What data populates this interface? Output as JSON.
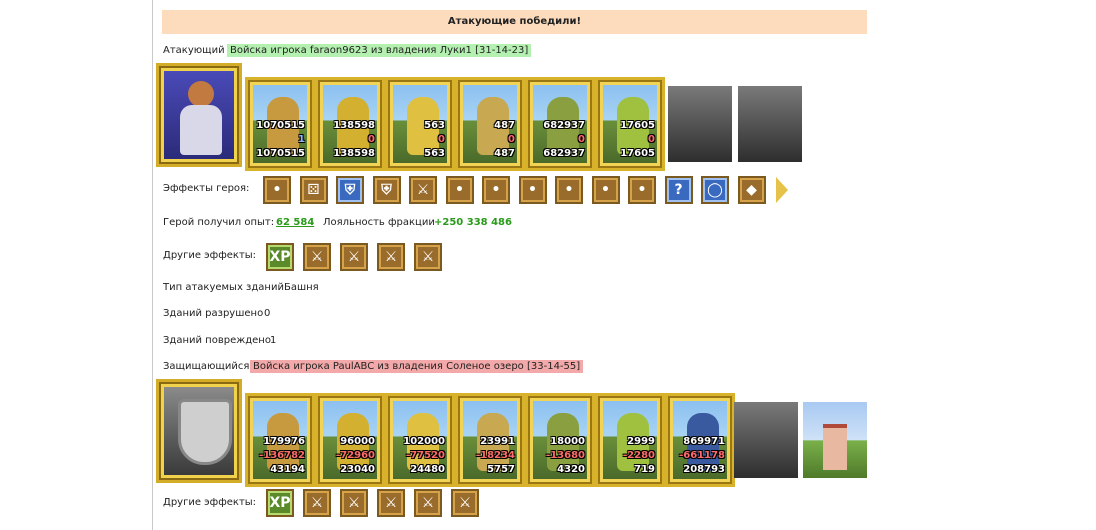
{
  "banner": "Атакующие победили!",
  "attacker": {
    "label": "Атакующий",
    "desc": "Войска игрока faraon9623 из владения Луки1 [31-14-23]",
    "units": [
      {
        "name": "pikeman",
        "top": "1070515",
        "mid": "1",
        "bot": "1070515",
        "color": "#c89a40"
      },
      {
        "name": "archer",
        "top": "138598",
        "mid": "0",
        "bot": "138598",
        "color": "#d4b030"
      },
      {
        "name": "knight",
        "top": "563",
        "mid": "0",
        "bot": "563",
        "color": "#e0c040"
      },
      {
        "name": "cavalry",
        "top": "487",
        "mid": "0",
        "bot": "487",
        "color": "#c8a850"
      },
      {
        "name": "crossbow",
        "top": "682937",
        "mid": "0",
        "bot": "682937",
        "color": "#8aa040"
      },
      {
        "name": "mage",
        "top": "17605",
        "mid": "0",
        "bot": "17605",
        "color": "#a0c040"
      },
      {
        "name": "ghost-1",
        "top": "",
        "mid": "",
        "bot": "",
        "color": "#555"
      },
      {
        "name": "ghost-2",
        "top": "",
        "mid": "",
        "bot": "",
        "color": "#555"
      }
    ],
    "hero_effects_label": "Эффекты героя:",
    "hero_effects": [
      "tent-icon",
      "dice-icon",
      "shield-icon",
      "hand-shield-icon",
      "sword-icon",
      "handshake-icon",
      "hand-icon",
      "scroll-icon",
      "helmet-icon",
      "chest-icon",
      "armor-icon",
      "question-icon",
      "ring-icon",
      "crystal-icon"
    ],
    "exp_label": "Герой получил опыт:",
    "exp_value": "62 584",
    "loyalty_label": "Лояльность фракции",
    "loyalty_value": "+250 338 486",
    "other_effects_label": "Другие эффекты:",
    "other_effects": [
      "XP",
      "heart-sword-icon",
      "sword-icon",
      "sword-icon",
      "sword-icon"
    ]
  },
  "buildings": {
    "type_label": "Тип атакуемых зданий",
    "type_value": "Башня",
    "destroyed_label": "Зданий разрушено",
    "destroyed_value": "0",
    "damaged_label": "Зданий повреждено",
    "damaged_value": "1"
  },
  "defender": {
    "label": "Защищающийся",
    "desc": "Войска игрока PaulABC из владения Соленое озеро [33-14-55]",
    "units": [
      {
        "name": "pikeman",
        "top": "179976",
        "mid": "-136782",
        "bot": "43194",
        "color": "#c89a40"
      },
      {
        "name": "archer",
        "top": "96000",
        "mid": "-72960",
        "bot": "23040",
        "color": "#d4b030"
      },
      {
        "name": "knight",
        "top": "102000",
        "mid": "-77520",
        "bot": "24480",
        "color": "#e0c040"
      },
      {
        "name": "cavalry",
        "top": "23991",
        "mid": "-18234",
        "bot": "5757",
        "color": "#c8a850"
      },
      {
        "name": "crossbow",
        "top": "18000",
        "mid": "-13680",
        "bot": "4320",
        "color": "#8aa040"
      },
      {
        "name": "mage",
        "top": "2999",
        "mid": "-2280",
        "bot": "719",
        "color": "#a0c040"
      },
      {
        "name": "assassin",
        "top": "869971",
        "mid": "-661178",
        "bot": "208793",
        "color": "#3a5aa0"
      }
    ],
    "other_effects_label": "Другие эффекты:",
    "other_effects": [
      "XP",
      "sword-icon",
      "sword-icon",
      "sword-icon",
      "sword-icon",
      "sword-icon"
    ]
  }
}
